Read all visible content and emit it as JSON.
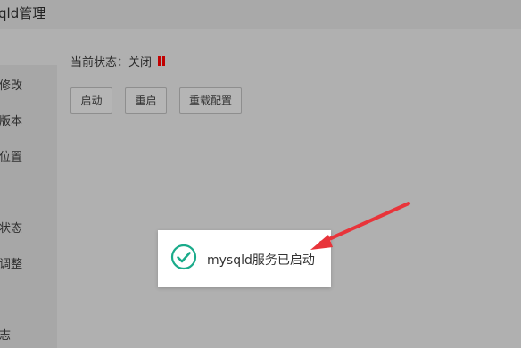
{
  "window": {
    "title": "qld管理"
  },
  "sidebar": {
    "items": [
      {
        "label": "修改"
      },
      {
        "label": "版本"
      },
      {
        "label": "位置"
      },
      {
        "label": "状态"
      },
      {
        "label": "调整"
      },
      {
        "label": "志"
      }
    ]
  },
  "status": {
    "label": "当前状态：",
    "value": "关闭",
    "icon": "stop-icon",
    "color": "#c20000"
  },
  "buttons": {
    "start": "启动",
    "restart": "重启",
    "reload": "重载配置"
  },
  "toast": {
    "message": "mysqld服务已启动",
    "icon": "check-circle-icon",
    "color": "#1aab8a"
  },
  "annotation": {
    "arrow_color": "#e8343a"
  }
}
